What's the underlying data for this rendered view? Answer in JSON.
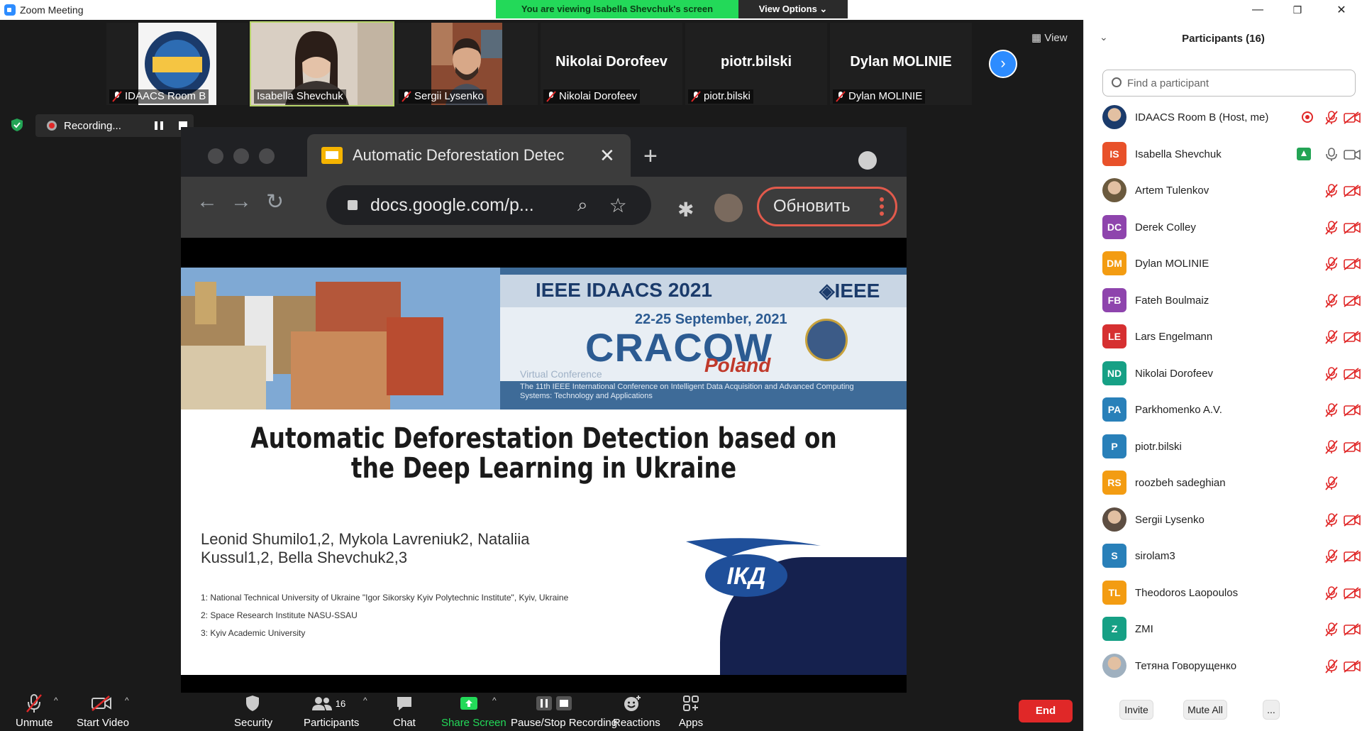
{
  "window": {
    "title": "Zoom Meeting",
    "minimize": "—",
    "maximize": "❐",
    "close": "✕"
  },
  "viewing_banner": {
    "message": "You are viewing Isabella Shevchuk's screen",
    "view_options": "View Options ⌄"
  },
  "thumbnails": [
    {
      "name": "IDAACS Room B",
      "type": "logo"
    },
    {
      "name": "Isabella Shevchuk",
      "type": "video"
    },
    {
      "name": "Sergii Lysenko",
      "type": "video"
    },
    {
      "name": "Nikolai Dorofeev",
      "type": "name",
      "big": "Nikolai Dorofeev"
    },
    {
      "name": "piotr.bilski",
      "type": "name",
      "big": "piotr.bilski"
    },
    {
      "name": "Dylan MOLINIE",
      "type": "name",
      "big": "Dylan MOLINIE"
    }
  ],
  "view_button": "View",
  "recording": {
    "label": "Recording..."
  },
  "shared_screen": {
    "tab_title": "Automatic Deforestation Detec",
    "url": "docs.google.com/p...",
    "update_button": "Обновить",
    "slide": {
      "event_title": "IEEE IDAACS 2021",
      "ieee": "◈IEEE",
      "dates": "22-25 September, 2021",
      "city": "CRACOW",
      "country": "Poland",
      "virtual": "Virtual Conference",
      "conference": "The 11th IEEE International Conference on Intelligent Data Acquisition and Advanced Computing Systems: Technology and Applications",
      "title": "Automatic Deforestation Detection based on the Deep Learning in Ukraine",
      "authors": "Leonid Shumilo1,2, Mykola Lavreniuk2, Nataliia Kussul1,2, Bella Shevchuk2,3",
      "affiliations": [
        "1: National Technical University of Ukraine \"Igor Sikorsky Kyiv Polytechnic Institute\", Kyiv, Ukraine",
        "2: Space Research Institute NASU-SSAU",
        "3: Kyiv Academic University"
      ],
      "logo_text": "ІКД"
    }
  },
  "toolbar": {
    "unmute": "Unmute",
    "start_video": "Start Video",
    "security": "Security",
    "participants": "Participants",
    "participants_count": "16",
    "chat": "Chat",
    "share_screen": "Share Screen",
    "pause_stop_recording": "Pause/Stop Recording",
    "reactions": "Reactions",
    "apps": "Apps",
    "end": "End"
  },
  "participants_panel": {
    "header": "Participants (16)",
    "search_placeholder": "Find a participant",
    "participants": [
      {
        "initials": "",
        "name": "IDAACS Room B (Host, me)",
        "color": "#1b3b6b",
        "photo": true,
        "recording": true
      },
      {
        "initials": "IS",
        "name": "Isabella Shevchuk",
        "color": "#e8512a",
        "sharing": true,
        "mic_on": true
      },
      {
        "initials": "",
        "name": "Artem Tulenkov",
        "color": "#6b5a3e",
        "photo": true
      },
      {
        "initials": "DC",
        "name": "Derek Colley",
        "color": "#8e44ad"
      },
      {
        "initials": "DM",
        "name": "Dylan MOLINIE",
        "color": "#f39c12"
      },
      {
        "initials": "FB",
        "name": "Fateh Boulmaiz",
        "color": "#8e44ad"
      },
      {
        "initials": "LE",
        "name": "Lars Engelmann",
        "color": "#d63031"
      },
      {
        "initials": "ND",
        "name": "Nikolai Dorofeev",
        "color": "#16a085"
      },
      {
        "initials": "PA",
        "name": "Parkhomenko A.V.",
        "color": "#2980b9"
      },
      {
        "initials": "P",
        "name": "piotr.bilski",
        "color": "#2980b9"
      },
      {
        "initials": "RS",
        "name": "roozbeh sadeghian",
        "color": "#f39c12",
        "no_video": true
      },
      {
        "initials": "",
        "name": "Sergii Lysenko",
        "color": "#5d4e42",
        "photo": true
      },
      {
        "initials": "S",
        "name": "sirolam3",
        "color": "#2980b9"
      },
      {
        "initials": "TL",
        "name": "Theodoros Laopoulos",
        "color": "#f39c12"
      },
      {
        "initials": "Z",
        "name": "ZMI",
        "color": "#16a085"
      },
      {
        "initials": "",
        "name": "Тетяна Говорущенко",
        "color": "#9fb0bf",
        "photo": true
      }
    ],
    "invite": "Invite",
    "mute_all": "Mute All",
    "more": "..."
  }
}
